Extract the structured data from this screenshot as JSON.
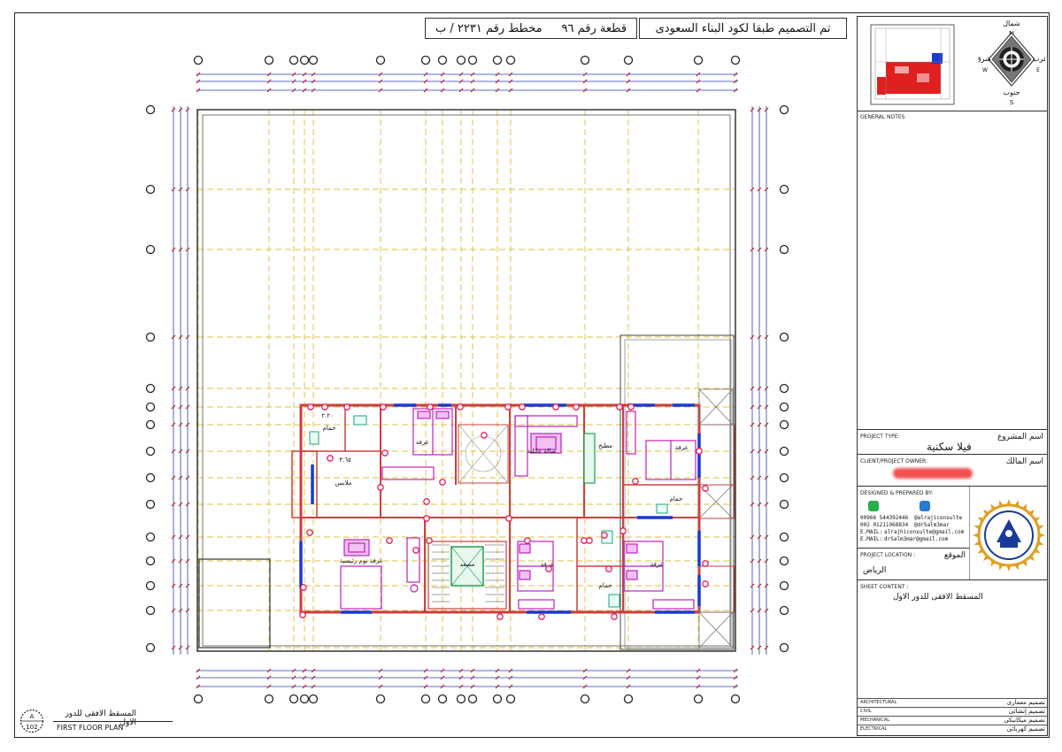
{
  "header": {
    "code_note": "تم التصميم طبقا لكود البناء السعودى",
    "plot_number": "قطعة رقم ٩٦",
    "scheme_number": "مخطط رقم ٢٢٣١ / ب"
  },
  "compass": {
    "north_ar": "شمال",
    "east_ar": "شرق",
    "west_ar": "غرب",
    "south_ar": "جنوب",
    "n": "N",
    "s": "S",
    "e": "E",
    "w": "W"
  },
  "title_block": {
    "general_notes": "GENERAL NOTES",
    "project_type_en": "PROJECT TYPE:",
    "project_type_ar": "اسم المشروع",
    "project_type_value": "فيلا سكنية",
    "client_en": "CLIENT/PROJECT OWNER:",
    "client_ar": "اسم المالك",
    "designed_en": "DESIGNED & PREPARED BY:",
    "contact": {
      "phone1": "00966 544392446",
      "phone2": "002 01211968834",
      "email_label": "E.MAIL:",
      "email1": "alrajhiconsulte@gmail.com",
      "email2": "drSalm3mar@gmail.com",
      "social1": "@alrajiconsulte",
      "social2": "@drSalm3mar"
    },
    "location_en": "PROJECT LOCATION :",
    "location_ar": "الموقع",
    "location_value": "الرياض",
    "sheet_content_en": "SHEET CONTENT :",
    "sheet_content_value": "المسقط الافقى للدور الاول",
    "disciplines": [
      {
        "en": "ARCHITECTURAL",
        "ar": "تصميم معمارى"
      },
      {
        "en": "CIVIL",
        "ar": "تصميم إنشائى"
      },
      {
        "en": "MECHANICAL",
        "ar": "تصميم ميكانيكى"
      },
      {
        "en": "ELECTRICAL",
        "ar": "تصميم كهربائى"
      }
    ]
  },
  "drawing": {
    "sheet_id_letter": "A",
    "sheet_id_number": "102",
    "plan_title_ar": "المسقط الافقى للدور الاول",
    "plan_title_en": "FIRST FLOOR PLAN",
    "rooms": [
      {
        "key": "bath1",
        "label": "حمام"
      },
      {
        "key": "bath1b",
        "label": "٢.٢٠"
      },
      {
        "key": "bedroom1",
        "label": "غرفة"
      },
      {
        "key": "dressing",
        "label": "ملابس"
      },
      {
        "key": "dressing_dim",
        "label": "٣.٦٥"
      },
      {
        "key": "family",
        "label": "صالة عائلية"
      },
      {
        "key": "kitchen",
        "label": "مطبخ"
      },
      {
        "key": "bedroom2",
        "label": "غرفة"
      },
      {
        "key": "bath2",
        "label": "حمام"
      },
      {
        "key": "master",
        "label": "غرفة نوم رئيسية"
      },
      {
        "key": "bedroom3",
        "label": "غرفة"
      },
      {
        "key": "bath3",
        "label": "حمام"
      },
      {
        "key": "bedroom4",
        "label": "غرفة"
      },
      {
        "key": "stair",
        "label": "مصعد"
      }
    ]
  },
  "colors": {
    "grid": "#e0c040",
    "wall": "#c84040",
    "window": "#1a3ad0",
    "furniture": "#c020c0",
    "marker": "#e8205a",
    "dim": "#2a3bb0"
  }
}
